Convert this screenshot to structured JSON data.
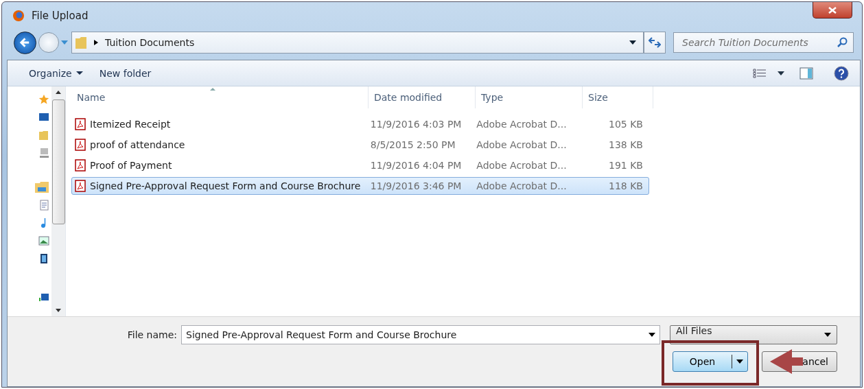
{
  "window": {
    "title": "File Upload"
  },
  "address": {
    "path": "Tuition Documents"
  },
  "search": {
    "placeholder": "Search Tuition Documents"
  },
  "toolbar": {
    "organize": "Organize",
    "new_folder": "New folder"
  },
  "table": {
    "columns": [
      "Name",
      "Date modified",
      "Type",
      "Size"
    ],
    "rows": [
      {
        "name": "Itemized Receipt",
        "date": "11/9/2016 4:03 PM",
        "type": "Adobe Acrobat D...",
        "size": "105 KB",
        "selected": false
      },
      {
        "name": "proof of attendance",
        "date": "8/5/2015 2:50 PM",
        "type": "Adobe Acrobat D...",
        "size": "138 KB",
        "selected": false
      },
      {
        "name": "Proof of Payment",
        "date": "11/9/2016 4:04 PM",
        "type": "Adobe Acrobat D...",
        "size": "191 KB",
        "selected": false
      },
      {
        "name": "Signed Pre-Approval Request Form and Course Brochure",
        "date": "11/9/2016 3:46 PM",
        "type": "Adobe Acrobat D...",
        "size": "118 KB",
        "selected": true
      }
    ]
  },
  "footer": {
    "file_name_label": "File name:",
    "file_name": "Signed Pre-Approval Request Form and Course Brochure",
    "filter": "All Files",
    "open": "Open",
    "cancel": "ancel"
  }
}
